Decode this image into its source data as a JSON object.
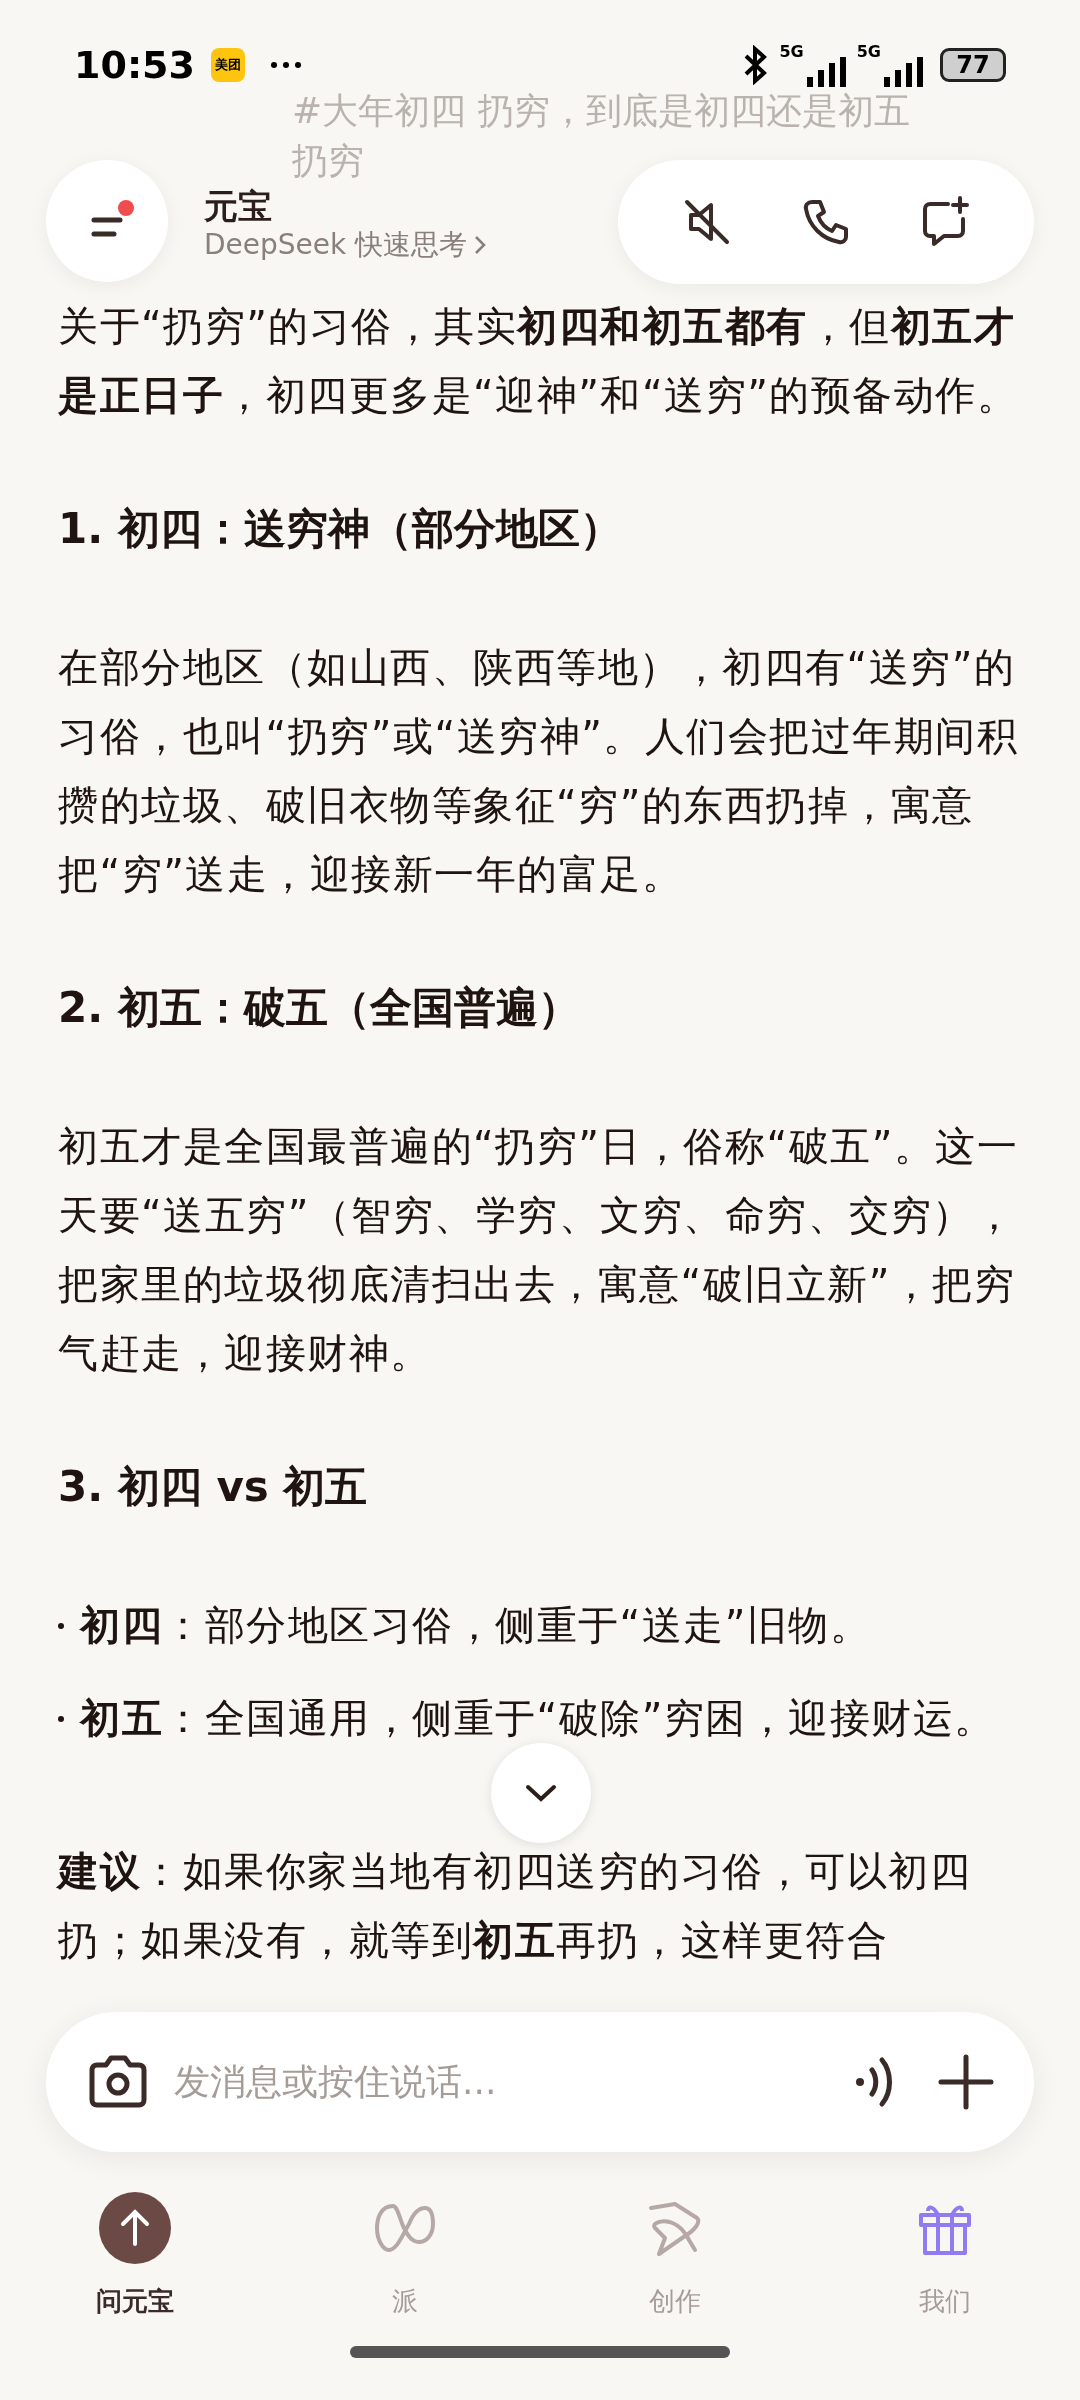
{
  "status_bar": {
    "time": "10:53",
    "app_badge": "美团",
    "network_1": "5G",
    "network_2": "5G",
    "battery": "77"
  },
  "faded_title": "#大年初四 扔穷，到底是初四还是初五扔穷",
  "header": {
    "title": "元宝",
    "subtitle": "DeepSeek 快速思考",
    "menu_unread": true
  },
  "content": [
    {
      "kind": "paragraph",
      "text": "关于“扔穷”的习俗，其实**初四和初五都有**，但**初五才是正日子**，初四更多是“迎神”和“送穷”的预备动作。"
    },
    {
      "kind": "heading",
      "text": "1. 初四：送穷神（部分地区）"
    },
    {
      "kind": "paragraph",
      "text": "在部分地区（如山西、陕西等地），初四有“送穷”的习俗，也叫“扔穷”或“送穷神”。人们会把过年期间积攒的垃圾、破旧衣物等象征“穷”的东西扔掉，寓意把“穷”送走，迎接新一年的富足。"
    },
    {
      "kind": "heading",
      "text": "2. 初五：破五（全国普遍）"
    },
    {
      "kind": "paragraph",
      "text": "初五才是全国最普遍的“扔穷”日，俗称“破五”。这一天要“送五穷”（智穷、学穷、文穷、命穷、交穷），把家里的垃圾彻底清扫出去，寓意“破旧立新”，把穷气赶走，迎接财神。"
    },
    {
      "kind": "heading",
      "text": "3. 初四 vs 初五"
    },
    {
      "kind": "bullet",
      "text": "**初四**：部分地区习俗，侧重于“送走”旧物。"
    },
    {
      "kind": "bullet",
      "text": "**初五**：全国通用，侧重于“破除”穷困，迎接财运。"
    },
    {
      "kind": "paragraph",
      "text": "**建议**：如果你家当地有初四送穷的习俗，可以初四扔；如果没有，就等到**初五**再扔，这样更符合"
    }
  ],
  "input": {
    "placeholder": "发消息或按住说话..."
  },
  "nav": [
    {
      "label": "问元宝",
      "selected": true
    },
    {
      "label": "派",
      "selected": false
    },
    {
      "label": "创作",
      "selected": false
    },
    {
      "label": "我们",
      "selected": false
    }
  ]
}
